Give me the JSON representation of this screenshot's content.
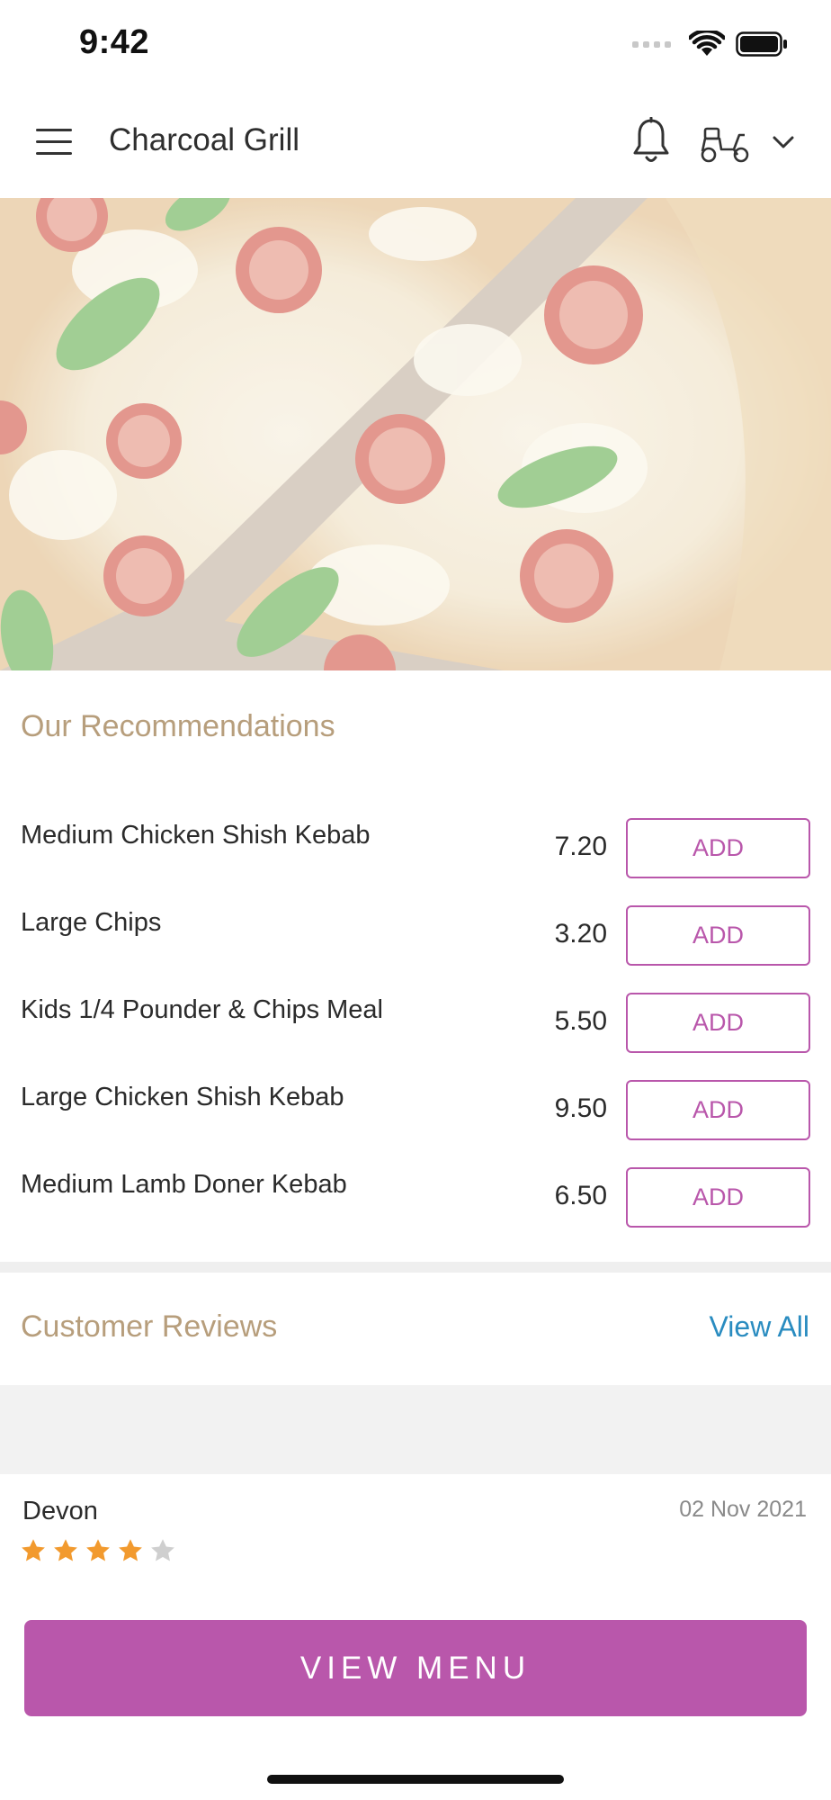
{
  "status_bar": {
    "time": "9:42"
  },
  "header": {
    "title": "Charcoal Grill"
  },
  "recommendations": {
    "title": "Our Recommendations",
    "items": [
      {
        "name": "Medium Chicken Shish Kebab",
        "price": "7.20",
        "button": "ADD"
      },
      {
        "name": "Large Chips",
        "price": "3.20",
        "button": "ADD"
      },
      {
        "name": "Kids 1/4 Pounder & Chips Meal",
        "price": "5.50",
        "button": "ADD"
      },
      {
        "name": "Large Chicken Shish Kebab",
        "price": "9.50",
        "button": "ADD"
      },
      {
        "name": "Medium Lamb Doner Kebab",
        "price": "6.50",
        "button": "ADD"
      }
    ]
  },
  "reviews": {
    "title": "Customer Reviews",
    "view_all": "View All",
    "items": [
      {
        "author": "Devon",
        "date": "02 Nov 2021",
        "rating": 4,
        "max_rating": 5
      }
    ]
  },
  "cta": {
    "label": "VIEW MENU"
  },
  "colors": {
    "accent": "#b957ab",
    "section_title": "#b79e7c",
    "link": "#2a8cc0",
    "star_filled": "#f29a2e",
    "star_empty": "#cfcfcf"
  },
  "icons": [
    "menu-icon",
    "bell-icon",
    "scooter-icon",
    "chevron-down-icon",
    "star-icon",
    "signal-icon",
    "wifi-icon",
    "battery-icon"
  ]
}
